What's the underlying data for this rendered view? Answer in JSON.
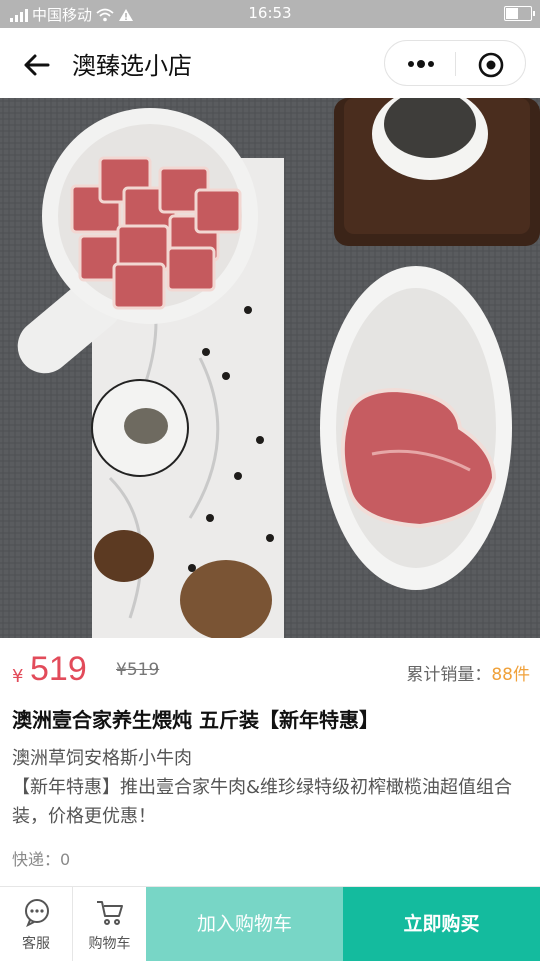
{
  "status_bar": {
    "carrier": "中国移动",
    "time": "16:53",
    "battery_level": 0.55
  },
  "nav": {
    "title": "澳臻选小店"
  },
  "product": {
    "currency_symbol": "¥",
    "price": "519",
    "original_price": "¥519",
    "sales_label": "累计销量：",
    "sales_count": "88",
    "sales_unit": "件",
    "title": "澳洲壹合家养生煨炖 五斤装【新年特惠】",
    "desc_line1": "澳洲草饲安格斯小牛肉",
    "desc_line2": "【新年特惠】推出壹合家牛肉&维珍绿特级初榨橄榄油超值组合装，价格更优惠！",
    "shipping": "快递：0"
  },
  "bottom_bar": {
    "service_label": "客服",
    "cart_label": "购物车",
    "add_cart_label": "加入购物车",
    "buy_now_label": "立即购买"
  },
  "colors": {
    "price_red": "#e24b5a",
    "sales_orange": "#f0a13a",
    "add_cart_bg": "#78d6c6",
    "buy_now_bg": "#14bb9e",
    "status_bar_bg": "#b4b4b4"
  },
  "icons": [
    "back-arrow-icon",
    "more-icon",
    "close-mini-program-icon",
    "chat-icon",
    "cart-icon",
    "wifi-icon",
    "warning-icon",
    "signal-icon",
    "battery-icon"
  ]
}
